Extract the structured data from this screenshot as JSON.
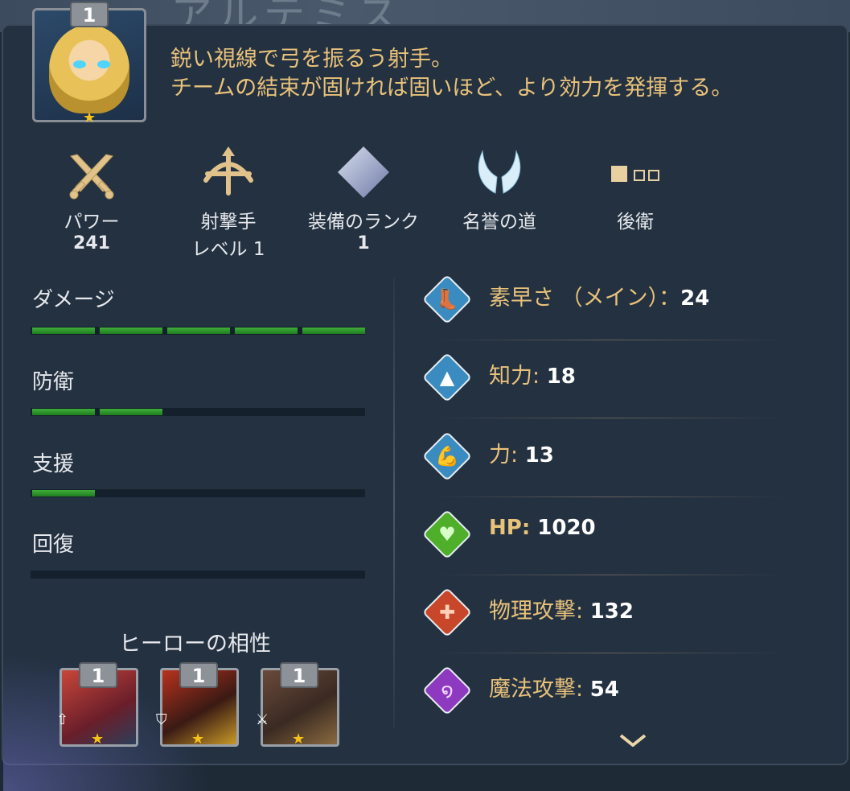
{
  "hero": {
    "level": "1",
    "description_line1": "鋭い視線で弓を振るう射手。",
    "description_line2": "チームの結束が固ければ固いほど、より効力を発揮する。"
  },
  "attributes": [
    {
      "label": "パワー",
      "value": "241",
      "icon": "crossed-swords-icon"
    },
    {
      "label": "射撃手",
      "value": "レベル 1",
      "icon": "bow-icon"
    },
    {
      "label": "装備のランク",
      "value": "1",
      "icon": "rank-diamond-icon"
    },
    {
      "label": "名誉の道",
      "value": "",
      "icon": "wings-icon"
    },
    {
      "label": "後衛",
      "value": "",
      "icon": "position-slots-icon"
    }
  ],
  "roles": [
    {
      "label": "ダメージ",
      "filled": 5,
      "total": 5
    },
    {
      "label": "防衛",
      "filled": 2,
      "total": 5
    },
    {
      "label": "支援",
      "filled": 1,
      "total": 5
    },
    {
      "label": "回復",
      "filled": 0,
      "total": 5
    }
  ],
  "stats": [
    {
      "label": "素早さ （メイン）",
      "value": "24",
      "icon": "agility-icon",
      "color": "#3a8cc0"
    },
    {
      "label": "知力",
      "value": "18",
      "icon": "intelligence-icon",
      "color": "#3a8cc0"
    },
    {
      "label": "力",
      "value": "13",
      "icon": "strength-icon",
      "color": "#3a8cc0"
    },
    {
      "label": "HP",
      "value": "1020",
      "icon": "heart-icon",
      "color": "#4fae2a"
    },
    {
      "label": "物理攻撃",
      "value": "132",
      "icon": "sword-icon",
      "color": "#c8472a"
    },
    {
      "label": "魔法攻撃",
      "value": "54",
      "icon": "magic-swirl-icon",
      "color": "#8e3ac0"
    }
  ],
  "synergy": {
    "title": "ヒーローの相性",
    "heroes": [
      {
        "level": "1",
        "badge": "arrow-up-icon"
      },
      {
        "level": "1",
        "badge": "shield-icon"
      },
      {
        "level": "1",
        "badge": "axe-icon"
      }
    ]
  },
  "colors": {
    "accent_gold": "#e9c27a",
    "bar_green": "#2f9a2c",
    "panel": "#233141"
  }
}
